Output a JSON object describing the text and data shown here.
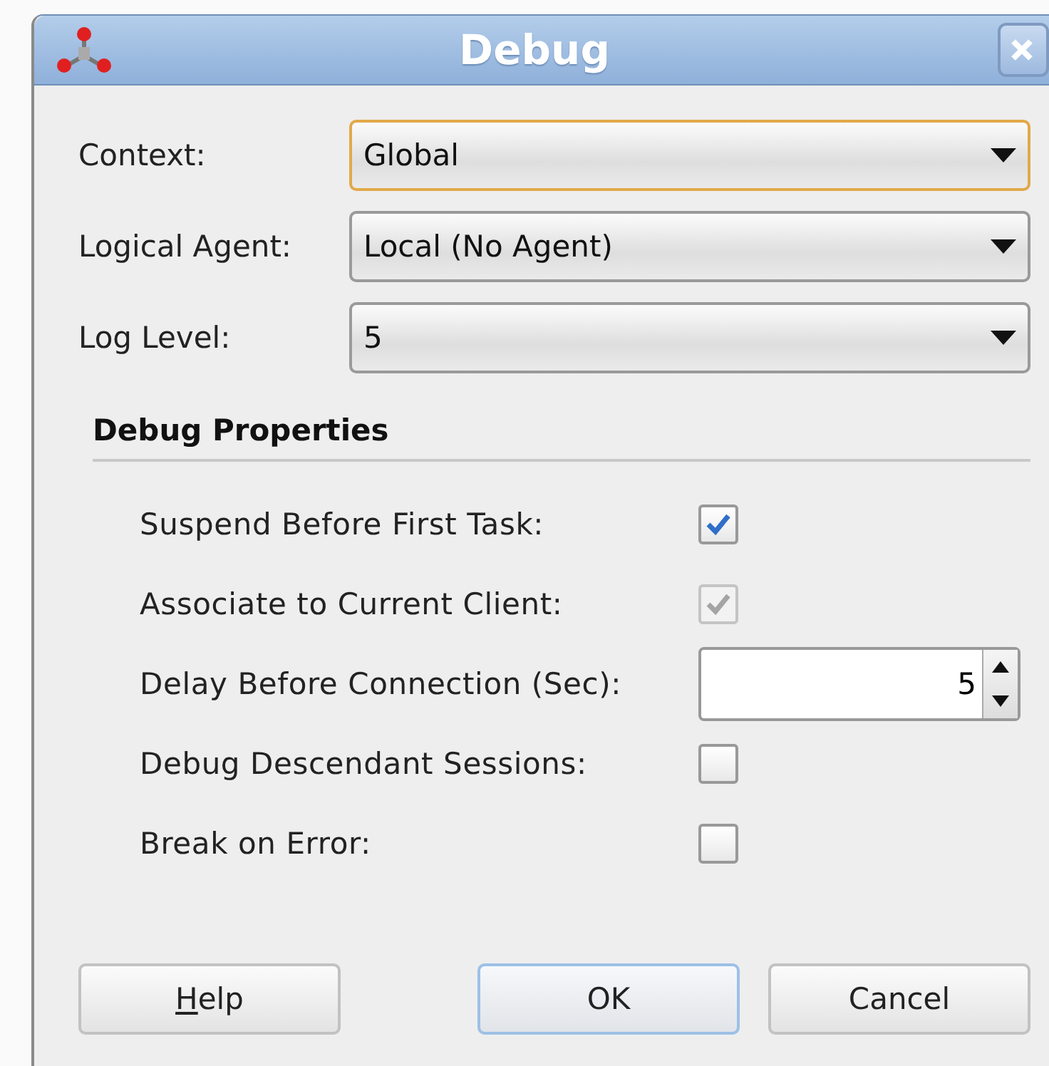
{
  "window": {
    "title": "Debug"
  },
  "fields": [
    {
      "label": "Context:",
      "value": "Global",
      "focused": true
    },
    {
      "label": "Logical Agent:",
      "value": "Local (No Agent)",
      "focused": false
    },
    {
      "label": "Log Level:",
      "value": "5",
      "focused": false
    }
  ],
  "section": {
    "title": "Debug Properties"
  },
  "options": [
    {
      "kind": "checkbox",
      "label": "Suspend Before First Task:",
      "checked": true,
      "disabled": false
    },
    {
      "kind": "checkbox",
      "label": "Associate to Current Client:",
      "checked": true,
      "disabled": true
    },
    {
      "kind": "spinner",
      "label": "Delay Before Connection (Sec):",
      "value": "5"
    },
    {
      "kind": "checkbox",
      "label": "Debug Descendant Sessions:",
      "checked": false,
      "disabled": false
    },
    {
      "kind": "checkbox",
      "label": "Break on Error:",
      "checked": false,
      "disabled": false
    }
  ],
  "buttons": [
    {
      "label": "Help",
      "default": false,
      "mnemonic_first": true
    },
    {
      "label": "OK",
      "default": true,
      "mnemonic_first": false
    },
    {
      "label": "Cancel",
      "default": false,
      "mnemonic_first": false
    }
  ]
}
